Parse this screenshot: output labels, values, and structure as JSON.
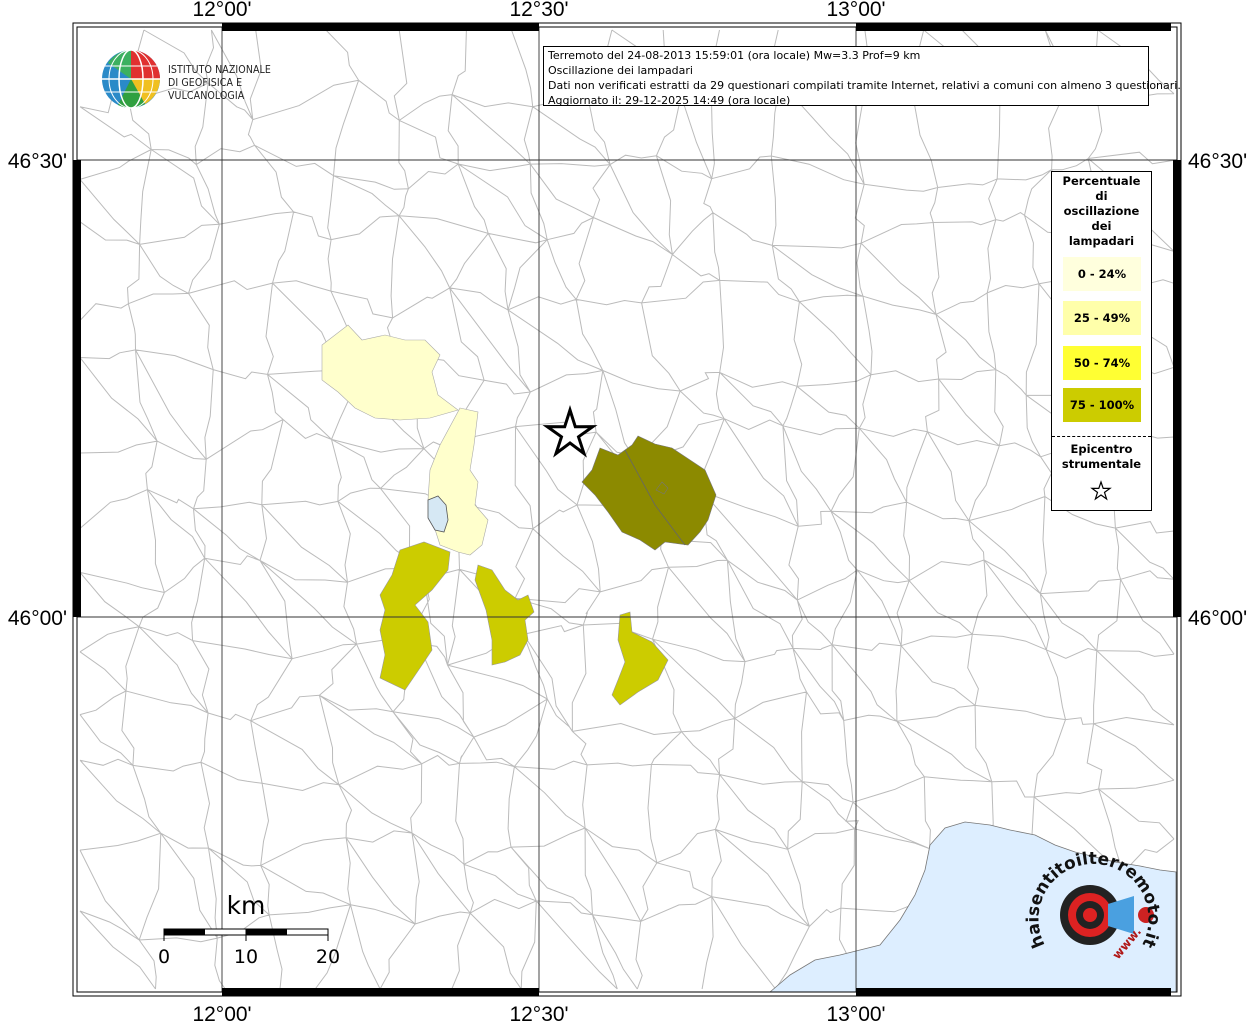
{
  "info": {
    "line1": "Terremoto del 24-08-2013 15:59:01 (ora locale) Mw=3.3 Prof=9 km",
    "line2": "Oscillazione dei lampadari",
    "line3": "Dati non verificati estratti da 29 questionari compilati tramite Internet, relativi a comuni con almeno 3 questionari.",
    "line4": "Aggiornato il: 29-12-2025 14:49 (ora locale)"
  },
  "logo": {
    "line1": "ISTITUTO NAZIONALE",
    "line2": "DI GEOFISICA E VULCANOLOGIA"
  },
  "axes": {
    "lon_top": [
      "12°00'",
      "12°30'",
      "13°00'"
    ],
    "lon_bottom": [
      "12°00'",
      "12°30'",
      "13°00'"
    ],
    "lat_left": [
      "46°30'",
      "46°00'"
    ],
    "lat_right": [
      "46°30'",
      "46°00'"
    ]
  },
  "legend": {
    "title": [
      "Percentuale",
      "di",
      "oscillazione",
      "dei",
      "lampadari"
    ],
    "classes": [
      {
        "label": "0 - 24%",
        "color": "#ffffdd"
      },
      {
        "label": "25 - 49%",
        "color": "#ffffaa"
      },
      {
        "label": "50 - 74%",
        "color": "#ffff33"
      },
      {
        "label": "75 - 100%",
        "color": "#cccc00"
      }
    ],
    "epicenter_title": [
      "Epicentro",
      "strumentale"
    ],
    "epicenter_icon": "star-outline"
  },
  "scale": {
    "unit": "km",
    "ticks": [
      "0",
      "10",
      "20"
    ]
  },
  "colors": {
    "class_0_24": "#ffffcc",
    "class_75_100": "#cccc00",
    "dark_olive": "#8c8a00",
    "sea": "#ddeeff",
    "lake": "#d6e8f4"
  },
  "watermark": {
    "text": "haisentitoilterremoto.it",
    "url": "www."
  }
}
